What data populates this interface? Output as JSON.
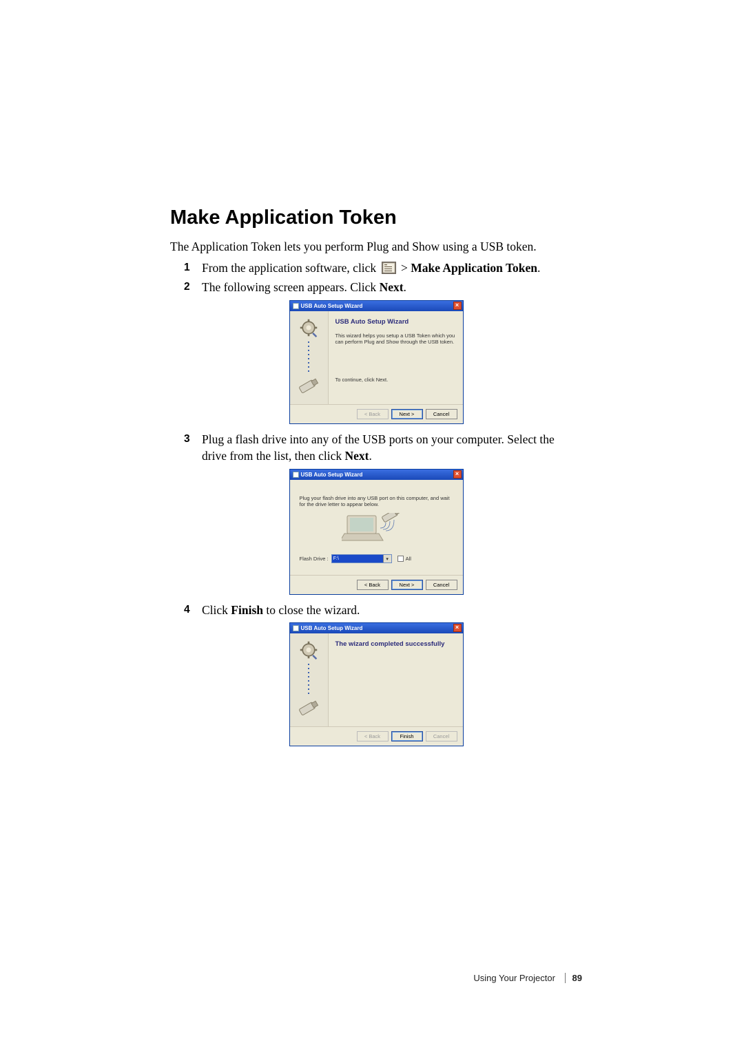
{
  "heading": "Make Application Token",
  "intro": "The Application Token lets you perform Plug and Show using a USB token.",
  "steps": {
    "s1": {
      "num": "1",
      "pre": "From the application software, click ",
      "post": " > ",
      "bold": "Make Application Token",
      "tail": "."
    },
    "s2": {
      "num": "2",
      "pre": "The following screen appears. Click ",
      "bold": "Next",
      "tail": "."
    },
    "s3": {
      "num": "3",
      "pre": "Plug a flash drive into any of the USB ports on your computer. Select the drive from the list, then click ",
      "bold": "Next",
      "tail": "."
    },
    "s4": {
      "num": "4",
      "pre": "Click ",
      "bold": "Finish",
      "post": " to close the wizard."
    }
  },
  "wizard_common": {
    "title": "USB Auto Setup Wizard",
    "back": "< Back",
    "next": "Next >",
    "cancel": "Cancel",
    "finish": "Finish"
  },
  "wiz1": {
    "heading": "USB Auto Setup Wizard",
    "desc": "This wizard helps you setup a USB Token which you can perform Plug and Show through the USB token.",
    "continue": "To continue, click Next."
  },
  "wiz2": {
    "instruction": "Plug your flash drive into any USB port on this computer, and wait for the drive letter to appear below.",
    "flash_drive_label": "Flash Drive :",
    "selected": "F:\\",
    "all_label": "All"
  },
  "wiz3": {
    "heading": "The wizard completed successfully"
  },
  "footer": {
    "section": "Using Your Projector",
    "page": "89"
  }
}
